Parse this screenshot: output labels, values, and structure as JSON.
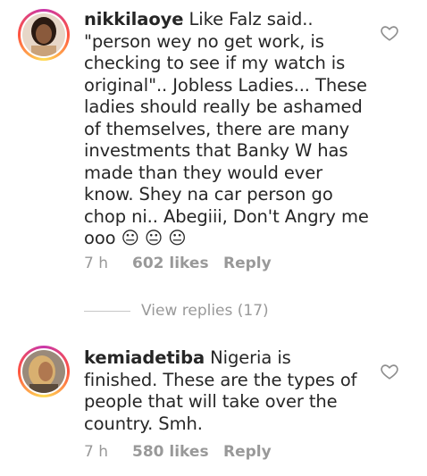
{
  "comments": [
    {
      "username": "nikkilaoye",
      "text": "Like Falz said.. \"person wey no get work, is checking to see if my watch is original\".. Jobless Ladies... These ladies should really be ashamed of themselves, there are many  investments that Banky W has made than they would ever know. Shey na car person go chop ni.. Abegiii, Don't Angry me ooo 😐 😐 😐",
      "time": "7 h",
      "likes": "602 likes",
      "reply": "Reply"
    },
    {
      "username": "kemiadetiba",
      "text": "Nigeria is finished. These are the types of people that will take over the country. Smh.",
      "time": "7 h",
      "likes": "580 likes",
      "reply": "Reply"
    }
  ],
  "view_replies": "View replies (17)",
  "icons": {
    "heart": "heart-outline-icon",
    "avatar_ring_colors": [
      "#c837ab",
      "#ff543e",
      "#ffdd55"
    ]
  }
}
